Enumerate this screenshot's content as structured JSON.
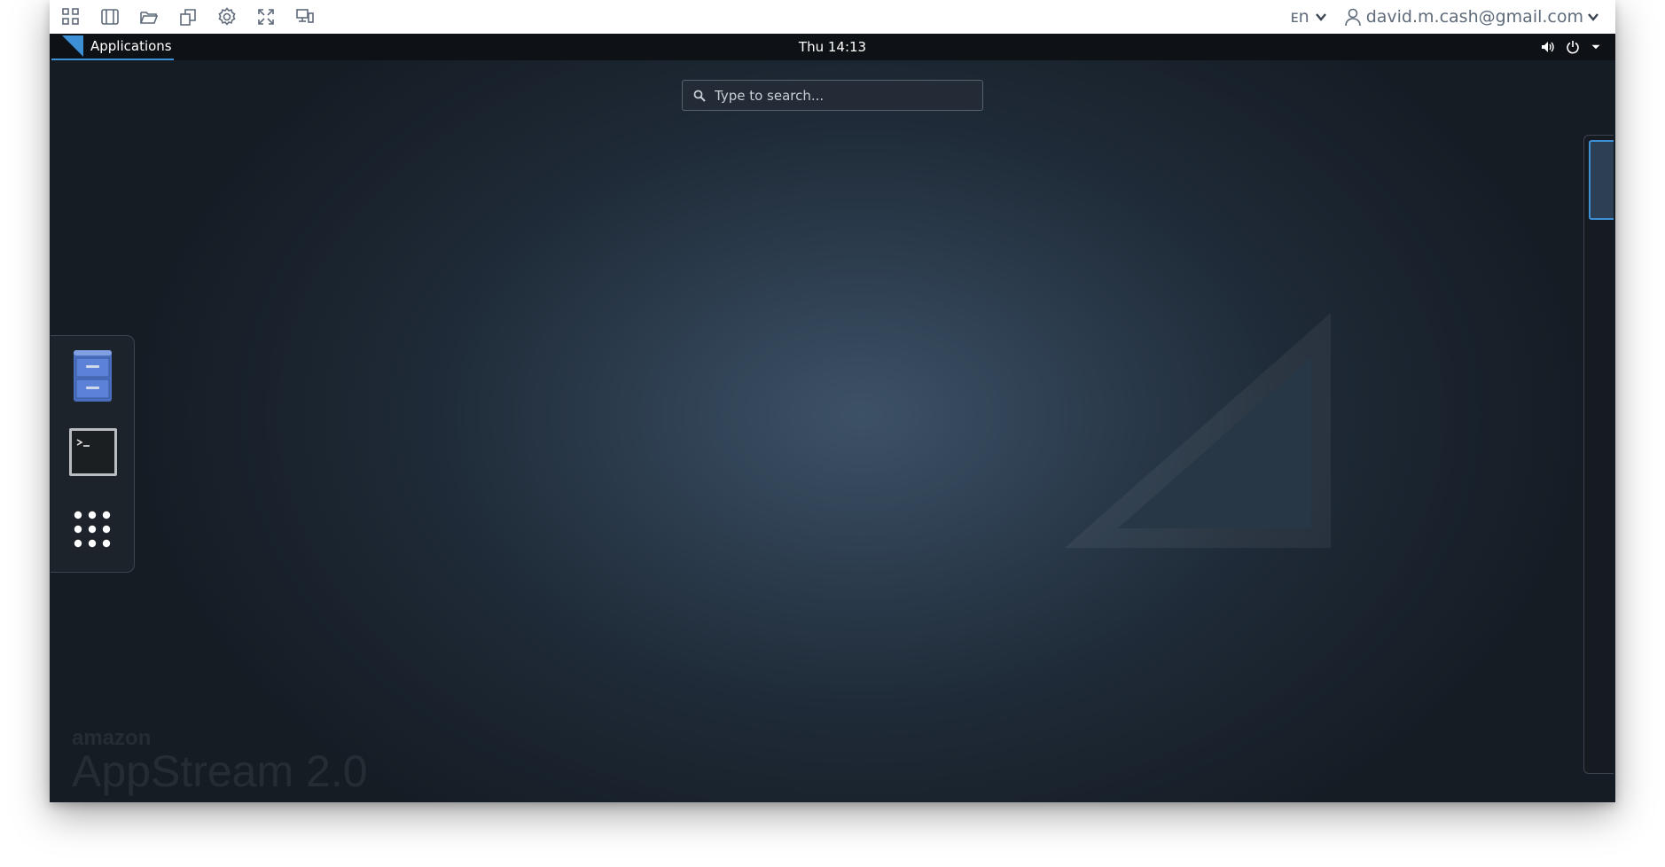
{
  "toolbar": {
    "icons": [
      "apps-grid-icon",
      "window-split-icon",
      "folder-open-icon",
      "clipboard-copy-icon",
      "settings-gear-icon",
      "fullscreen-icon",
      "display-icon"
    ],
    "language": "ᴇn",
    "user_email": "david.m.cash@gmail.com"
  },
  "topbar": {
    "activities_label": "Applications",
    "clock": "Thu 14:13",
    "system_icons": [
      "volume-icon",
      "power-icon",
      "dropdown-arrow-icon"
    ]
  },
  "search": {
    "placeholder": "Type to search..."
  },
  "dash": {
    "items": [
      {
        "name": "files-cabinet-icon"
      },
      {
        "name": "terminal-icon"
      },
      {
        "name": "show-applications-icon"
      }
    ]
  },
  "watermark": {
    "line1": "amazon",
    "line2": "AppStream 2.0"
  },
  "colors": {
    "accent": "#3d8fd6",
    "topbar_bg": "#0e1115",
    "desktop_center": "#3d5166",
    "desktop_edge": "#151c24"
  }
}
